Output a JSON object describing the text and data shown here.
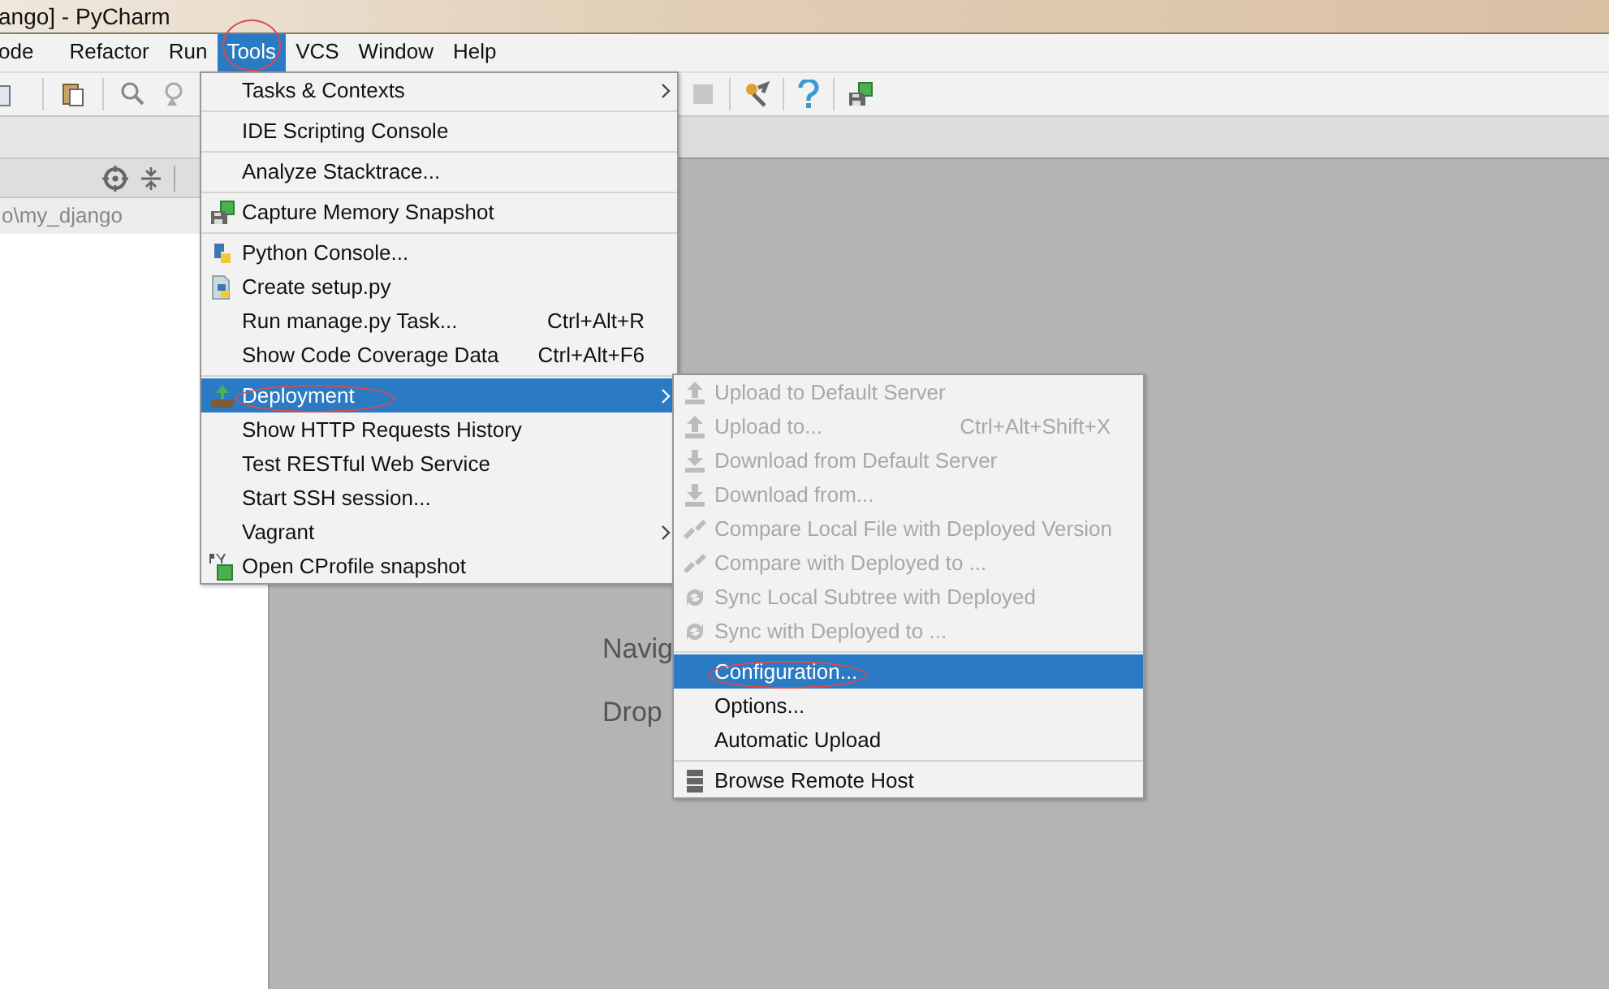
{
  "window": {
    "title": "ango] - PyCharm"
  },
  "menubar": [
    {
      "label": "ode",
      "selected": false,
      "circled": false
    },
    {
      "label": "Refactor",
      "selected": false,
      "circled": false
    },
    {
      "label": "Run",
      "selected": false,
      "circled": false
    },
    {
      "label": "Tools",
      "selected": true,
      "circled": true
    },
    {
      "label": "VCS",
      "selected": false,
      "circled": false
    },
    {
      "label": "Window",
      "selected": false,
      "circled": false
    },
    {
      "label": "Help",
      "selected": false,
      "circled": false
    }
  ],
  "project_panel": {
    "path": "o\\my_django"
  },
  "welcome": {
    "lines": [
      "Navig",
      "Drop"
    ]
  },
  "tools_menu": {
    "items": [
      {
        "kind": "item",
        "label": "Tasks & Contexts",
        "submenu": true,
        "selected": false,
        "circled": false
      },
      {
        "kind": "separator"
      },
      {
        "kind": "item",
        "label": "IDE Scripting Console",
        "submenu": false,
        "selected": false,
        "circled": false
      },
      {
        "kind": "separator"
      },
      {
        "kind": "item",
        "label": "Analyze Stacktrace...",
        "submenu": false,
        "selected": false,
        "circled": false
      },
      {
        "kind": "separator"
      },
      {
        "kind": "item",
        "label": "Capture Memory Snapshot",
        "submenu": false,
        "selected": false,
        "circled": false
      },
      {
        "kind": "separator"
      },
      {
        "kind": "item",
        "label": "Python Console...",
        "submenu": false,
        "selected": false,
        "circled": false
      },
      {
        "kind": "item",
        "label": "Create setup.py",
        "submenu": false,
        "selected": false,
        "circled": false
      },
      {
        "kind": "item",
        "label": "Run manage.py Task...",
        "shortcut": "Ctrl+Alt+R",
        "submenu": false,
        "selected": false,
        "circled": false
      },
      {
        "kind": "item",
        "label": "Show Code Coverage Data",
        "shortcut": "Ctrl+Alt+F6",
        "submenu": false,
        "selected": false,
        "circled": false
      },
      {
        "kind": "separator"
      },
      {
        "kind": "item",
        "label": "Deployment",
        "submenu": true,
        "selected": true,
        "circled": true
      },
      {
        "kind": "item",
        "label": "Show HTTP Requests History",
        "submenu": false,
        "selected": false,
        "circled": false
      },
      {
        "kind": "item",
        "label": "Test RESTful Web Service",
        "submenu": false,
        "selected": false,
        "circled": false
      },
      {
        "kind": "item",
        "label": "Start SSH session...",
        "submenu": false,
        "selected": false,
        "circled": false
      },
      {
        "kind": "item",
        "label": "Vagrant",
        "submenu": true,
        "selected": false,
        "circled": false
      },
      {
        "kind": "item",
        "label": "Open CProfile snapshot",
        "submenu": false,
        "selected": false,
        "circled": false
      }
    ]
  },
  "deployment_submenu": {
    "items": [
      {
        "kind": "item",
        "label": "Upload to Default Server",
        "disabled": true,
        "selected": false,
        "circled": false
      },
      {
        "kind": "item",
        "label": "Upload to...",
        "shortcut": "Ctrl+Alt+Shift+X",
        "disabled": true,
        "selected": false,
        "circled": false
      },
      {
        "kind": "item",
        "label": "Download from Default Server",
        "disabled": true,
        "selected": false,
        "circled": false
      },
      {
        "kind": "item",
        "label": "Download from...",
        "disabled": true,
        "selected": false,
        "circled": false
      },
      {
        "kind": "item",
        "label": "Compare Local File with Deployed Version",
        "disabled": true,
        "selected": false,
        "circled": false
      },
      {
        "kind": "item",
        "label": "Compare with Deployed to ...",
        "disabled": true,
        "selected": false,
        "circled": false
      },
      {
        "kind": "item",
        "label": "Sync Local Subtree with Deployed",
        "disabled": true,
        "selected": false,
        "circled": false
      },
      {
        "kind": "item",
        "label": "Sync with Deployed to ...",
        "disabled": true,
        "selected": false,
        "circled": false
      },
      {
        "kind": "separator"
      },
      {
        "kind": "item",
        "label": "Configuration...",
        "disabled": false,
        "selected": true,
        "circled": true
      },
      {
        "kind": "item",
        "label": "Options...",
        "disabled": false,
        "selected": false,
        "circled": false
      },
      {
        "kind": "item",
        "label": "Automatic Upload",
        "disabled": false,
        "selected": false,
        "circled": false
      },
      {
        "kind": "separator"
      },
      {
        "kind": "item",
        "label": "Browse Remote Host",
        "disabled": false,
        "selected": false,
        "circled": false
      }
    ]
  }
}
